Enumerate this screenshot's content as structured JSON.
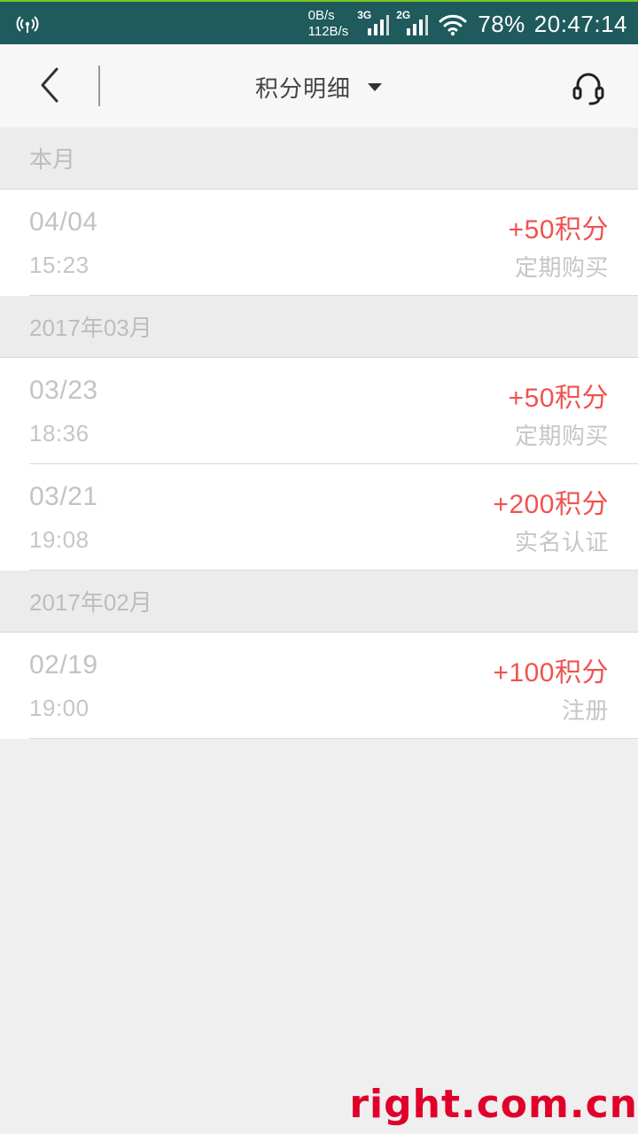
{
  "status_bar": {
    "net_down": "0B/s",
    "net_up": "112B/s",
    "sim1_label": "3G",
    "sim2_label": "2G",
    "battery": "78%",
    "time": "20:47:14",
    "icons": [
      "hotspot-icon",
      "signal-icon",
      "wifi-icon"
    ]
  },
  "toolbar": {
    "title": "积分明细",
    "icons": [
      "back-arrow-icon",
      "dropdown-caret-icon",
      "customer-service-headset-icon"
    ]
  },
  "sections": [
    {
      "header": "本月",
      "items": [
        {
          "date": "04/04",
          "time": "15:23",
          "points": "+50积分",
          "desc": "定期购买"
        }
      ]
    },
    {
      "header": "2017年03月",
      "items": [
        {
          "date": "03/23",
          "time": "18:36",
          "points": "+50积分",
          "desc": "定期购买"
        },
        {
          "date": "03/21",
          "time": "19:08",
          "points": "+200积分",
          "desc": "实名认证"
        }
      ]
    },
    {
      "header": "2017年02月",
      "items": [
        {
          "date": "02/19",
          "time": "19:00",
          "points": "+100积分",
          "desc": "注册"
        }
      ]
    }
  ],
  "watermark": "right.com.cn",
  "colors": {
    "status_bar_bg": "#1f5a5c",
    "accent_points": "#ef5350",
    "page_bg": "#efefef"
  }
}
